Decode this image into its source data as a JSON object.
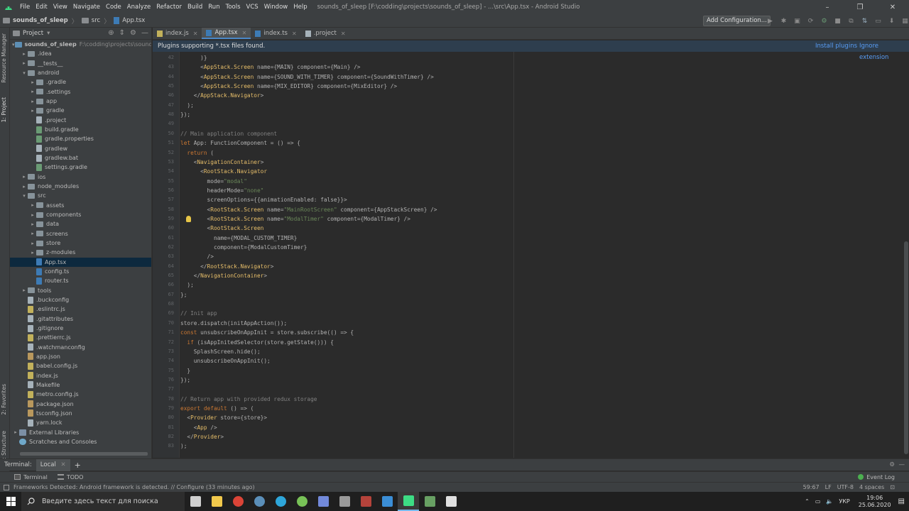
{
  "window": {
    "title": "sounds_of_sleep [F:\\codding\\projects\\sounds_of_sleep] - ...\\src\\App.tsx - Android Studio",
    "menu": [
      "File",
      "Edit",
      "View",
      "Navigate",
      "Code",
      "Analyze",
      "Refactor",
      "Build",
      "Run",
      "Tools",
      "VCS",
      "Window",
      "Help"
    ]
  },
  "navbar": {
    "crumbs": [
      "sounds_of_sleep",
      "src",
      "App.tsx"
    ],
    "add_configuration": "Add Configuration..."
  },
  "left_stripe": {
    "tabs": [
      "Resource Manager",
      "1: Project",
      "2: Favorites",
      "Z: Structure"
    ]
  },
  "project_panel": {
    "title": "Project",
    "items": [
      {
        "label": "sounds_of_sleep",
        "path": "F:\\codding\\projects\\sounds_of_sleep",
        "depth": 0,
        "type": "folder-blue",
        "arrow": "▾"
      },
      {
        "label": ".idea",
        "depth": 1,
        "type": "folder",
        "arrow": "▸"
      },
      {
        "label": "__tests__",
        "depth": 1,
        "type": "folder",
        "arrow": "▸"
      },
      {
        "label": "android",
        "depth": 1,
        "type": "folder",
        "arrow": "▾"
      },
      {
        "label": ".gradle",
        "depth": 2,
        "type": "folder",
        "arrow": "▸"
      },
      {
        "label": ".settings",
        "depth": 2,
        "type": "folder",
        "arrow": "▸"
      },
      {
        "label": "app",
        "depth": 2,
        "type": "folder",
        "arrow": "▸"
      },
      {
        "label": "gradle",
        "depth": 2,
        "type": "folder",
        "arrow": "▸"
      },
      {
        "label": ".project",
        "depth": 2,
        "type": "file",
        "arrow": ""
      },
      {
        "label": "build.gradle",
        "depth": 2,
        "type": "gradle",
        "arrow": ""
      },
      {
        "label": "gradle.properties",
        "depth": 2,
        "type": "gradle",
        "arrow": ""
      },
      {
        "label": "gradlew",
        "depth": 2,
        "type": "file",
        "arrow": ""
      },
      {
        "label": "gradlew.bat",
        "depth": 2,
        "type": "file",
        "arrow": ""
      },
      {
        "label": "settings.gradle",
        "depth": 2,
        "type": "gradle",
        "arrow": ""
      },
      {
        "label": "ios",
        "depth": 1,
        "type": "folder",
        "arrow": "▸"
      },
      {
        "label": "node_modules",
        "depth": 1,
        "type": "folder",
        "arrow": "▸"
      },
      {
        "label": "src",
        "depth": 1,
        "type": "folder",
        "arrow": "▾"
      },
      {
        "label": "assets",
        "depth": 2,
        "type": "folder",
        "arrow": "▸"
      },
      {
        "label": "components",
        "depth": 2,
        "type": "folder",
        "arrow": "▸"
      },
      {
        "label": "data",
        "depth": 2,
        "type": "folder",
        "arrow": "▸"
      },
      {
        "label": "screens",
        "depth": 2,
        "type": "folder",
        "arrow": "▸"
      },
      {
        "label": "store",
        "depth": 2,
        "type": "folder",
        "arrow": "▸"
      },
      {
        "label": "z-modules",
        "depth": 2,
        "type": "folder",
        "arrow": "▸"
      },
      {
        "label": "App.tsx",
        "depth": 2,
        "type": "ts",
        "arrow": "",
        "selected": true
      },
      {
        "label": "config.ts",
        "depth": 2,
        "type": "ts",
        "arrow": ""
      },
      {
        "label": "router.ts",
        "depth": 2,
        "type": "ts",
        "arrow": ""
      },
      {
        "label": "tools",
        "depth": 1,
        "type": "folder",
        "arrow": "▸"
      },
      {
        "label": ".buckconfig",
        "depth": 1,
        "type": "file",
        "arrow": ""
      },
      {
        "label": ".eslintrc.js",
        "depth": 1,
        "type": "js",
        "arrow": ""
      },
      {
        "label": ".gitattributes",
        "depth": 1,
        "type": "file",
        "arrow": ""
      },
      {
        "label": ".gitignore",
        "depth": 1,
        "type": "file",
        "arrow": ""
      },
      {
        "label": ".prettierrc.js",
        "depth": 1,
        "type": "js",
        "arrow": ""
      },
      {
        "label": ".watchmanconfig",
        "depth": 1,
        "type": "file",
        "arrow": ""
      },
      {
        "label": "app.json",
        "depth": 1,
        "type": "json",
        "arrow": ""
      },
      {
        "label": "babel.config.js",
        "depth": 1,
        "type": "js",
        "arrow": ""
      },
      {
        "label": "index.js",
        "depth": 1,
        "type": "js",
        "arrow": ""
      },
      {
        "label": "Makefile",
        "depth": 1,
        "type": "file",
        "arrow": ""
      },
      {
        "label": "metro.config.js",
        "depth": 1,
        "type": "js",
        "arrow": ""
      },
      {
        "label": "package.json",
        "depth": 1,
        "type": "json",
        "arrow": ""
      },
      {
        "label": "tsconfig.json",
        "depth": 1,
        "type": "json",
        "arrow": ""
      },
      {
        "label": "yarn.lock",
        "depth": 1,
        "type": "file",
        "arrow": ""
      },
      {
        "label": "External Libraries",
        "depth": 0,
        "type": "lib",
        "arrow": "▸"
      },
      {
        "label": "Scratches and Consoles",
        "depth": 0,
        "type": "scratch",
        "arrow": ""
      }
    ]
  },
  "editor_tabs": [
    {
      "label": "index.js",
      "active": false,
      "type": "js"
    },
    {
      "label": "App.tsx",
      "active": true,
      "type": "ts"
    },
    {
      "label": "index.ts",
      "active": false,
      "type": "ts"
    },
    {
      "label": ".project",
      "active": false,
      "type": "file"
    }
  ],
  "banner": {
    "message": "Plugins supporting *.tsx files found.",
    "install": "Install plugins",
    "ignore": "Ignore extension"
  },
  "code": {
    "first_line": 42,
    "bulb_line": 59,
    "lines": [
      "      )}",
      "      <AppStack.Screen name={MAIN} component={Main} />",
      "      <AppStack.Screen name={SOUND_WITH_TIMER} component={SoundWithTimer} />",
      "      <AppStack.Screen name={MIX_EDITOR} component={MixEditor} />",
      "    </AppStack.Navigator>",
      "  );",
      "});",
      "",
      "// Main application component",
      "let App: FunctionComponent = () => {",
      "  return (",
      "    <NavigationContainer>",
      "      <RootStack.Navigator",
      "        mode=\"modal\"",
      "        headerMode=\"none\"",
      "        screenOptions={{animationEnabled: false}}>",
      "        <RootStack.Screen name=\"MainRootScreen\" component={AppStackScreen} />",
      "        <RootStack.Screen name=\"ModalTimer\" component={ModalTimer} />",
      "        <RootStack.Screen",
      "          name={MODAL_CUSTOM_TIMER}",
      "          component={ModalCustomTimer}",
      "        />",
      "      </RootStack.Navigator>",
      "    </NavigationContainer>",
      "  );",
      "};",
      "",
      "// Init app",
      "store.dispatch(initAppAction());",
      "const unsubscribeOnAppInit = store.subscribe(() => {",
      "  if (isAppInitedSelector(store.getState())) {",
      "    SplashScreen.hide();",
      "    unsubscribeOnAppInit();",
      "  }",
      "});",
      "",
      "// Return app with provided redux storage",
      "export default () => (",
      "  <Provider store={store}>",
      "    <App />",
      "  </Provider>",
      ");"
    ]
  },
  "terminal": {
    "label": "Terminal:",
    "tab": "Local",
    "add": "+"
  },
  "bottom_tools": {
    "terminal": "Terminal",
    "todo": "TODO",
    "event_log": "Event Log"
  },
  "status": {
    "message": "Frameworks Detected: Android framework is detected. // Configure (33 minutes ago)",
    "position": "59:67",
    "line_sep": "LF",
    "encoding": "UTF-8",
    "indent": "4 spaces"
  },
  "taskbar": {
    "search_placeholder": "Введите здесь текст для поиска",
    "lang": "УКР",
    "time": "19:06",
    "date": "25.06.2020",
    "apps": [
      {
        "name": "task-view",
        "color": "#cfcfcf"
      },
      {
        "name": "file-explorer",
        "color": "#f2c94c"
      },
      {
        "name": "chrome",
        "color": "#db4437"
      },
      {
        "name": "steam",
        "color": "#5b8fb9"
      },
      {
        "name": "telegram",
        "color": "#2ea6da"
      },
      {
        "name": "utorrent",
        "color": "#78c257"
      },
      {
        "name": "discord",
        "color": "#7289da"
      },
      {
        "name": "app-editor",
        "color": "#9a9a9a"
      },
      {
        "name": "winrar",
        "color": "#b5433b"
      },
      {
        "name": "mail",
        "color": "#3b8ed6"
      },
      {
        "name": "android-studio",
        "color": "#3ddc84"
      },
      {
        "name": "node-app",
        "color": "#68a063"
      },
      {
        "name": "window-app",
        "color": "#e0e0e0"
      }
    ]
  }
}
